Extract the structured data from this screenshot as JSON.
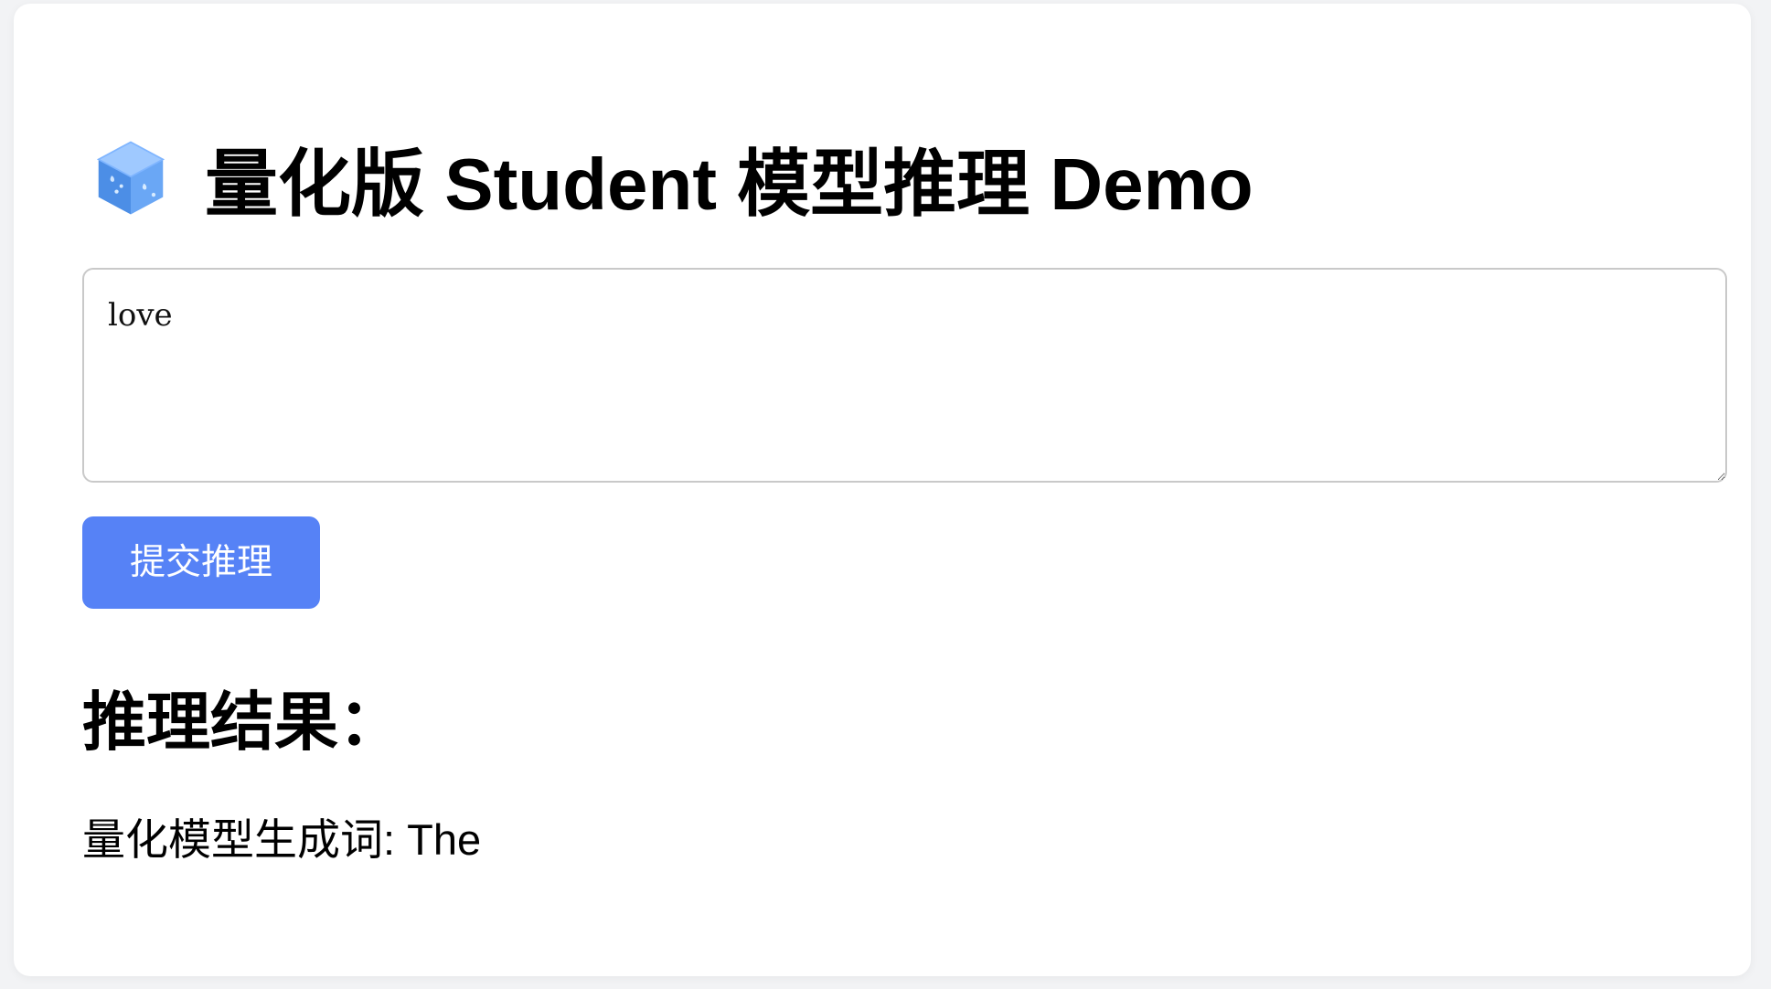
{
  "page": {
    "title": "量化版 Student 模型推理 Demo",
    "title_icon": "blue-cube-icon"
  },
  "input": {
    "value": "love"
  },
  "actions": {
    "submit_label": "提交推理"
  },
  "result": {
    "heading": "推理结果：",
    "label": "量化模型生成词: ",
    "value": "The"
  },
  "colors": {
    "page_background": "#f2f3f5",
    "card_background": "#ffffff",
    "button_background": "#5682f6",
    "button_text": "#ffffff",
    "input_border": "#c9c9c9"
  }
}
